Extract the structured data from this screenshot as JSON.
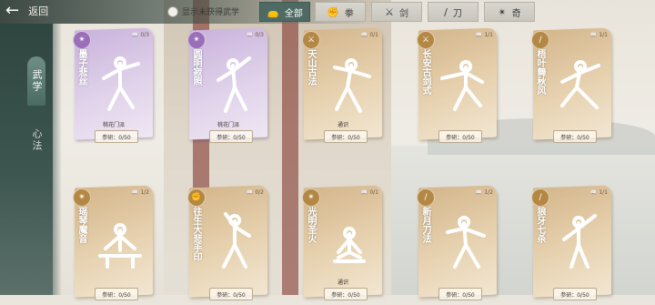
{
  "topbar": {
    "back_label": "返回",
    "back_icon": "arrow-left-icon",
    "show_unobtained_label": "显示未获得武学",
    "filters": [
      {
        "label": "全部",
        "icon": "bag-icon",
        "active": true
      },
      {
        "label": "拳",
        "icon": "fist-icon",
        "active": false
      },
      {
        "label": "剑",
        "icon": "sword-icon",
        "active": false
      },
      {
        "label": "刀",
        "icon": "blade-icon",
        "active": false
      },
      {
        "label": "奇",
        "icon": "shuriken-icon",
        "active": false
      }
    ]
  },
  "sidebar": {
    "tabs": [
      {
        "label": "武学",
        "active": true
      },
      {
        "label": "心法",
        "active": false
      }
    ]
  },
  "cards": [
    {
      "name": "墨子悲丝",
      "count": "0/3",
      "source": "桃花门派",
      "research": "参研：0/50",
      "theme": "purple",
      "type_icon": "shuriken-icon"
    },
    {
      "name": "圆明寂照",
      "count": "0/3",
      "source": "桃花门派",
      "research": "参研：0/50",
      "theme": "purple",
      "type_icon": "shuriken-icon"
    },
    {
      "name": "天山古法",
      "count": "0/1",
      "source": "通识",
      "research": "参研：0/50",
      "theme": "gold",
      "type_icon": "sword-icon"
    },
    {
      "name": "长安古剑式",
      "count": "1/1",
      "source": "",
      "research": "参研：0/50",
      "theme": "gold",
      "type_icon": "sword-icon"
    },
    {
      "name": "梧叶舞秋风",
      "count": "1/1",
      "source": "",
      "research": "参研：0/50",
      "theme": "gold",
      "type_icon": "blade-icon"
    },
    {
      "name": "瑶琴魔音",
      "count": "1/2",
      "source": "",
      "research": "参研：0/50",
      "theme": "gold",
      "type_icon": "shuriken-icon"
    },
    {
      "name": "往生大悲手印",
      "count": "0/2",
      "source": "",
      "research": "参研：0/50",
      "theme": "gold",
      "type_icon": "fist-icon"
    },
    {
      "name": "光明圣火",
      "count": "0/1",
      "source": "通识",
      "research": "参研：0/50",
      "theme": "gold",
      "type_icon": "shuriken-icon"
    },
    {
      "name": "新月刀法",
      "count": "1/2",
      "source": "",
      "research": "参研：0/50",
      "theme": "gold",
      "type_icon": "blade-icon"
    },
    {
      "name": "狼牙七杀",
      "count": "1/1",
      "source": "",
      "research": "参研：0/50",
      "theme": "gold",
      "type_icon": "blade-icon"
    }
  ]
}
